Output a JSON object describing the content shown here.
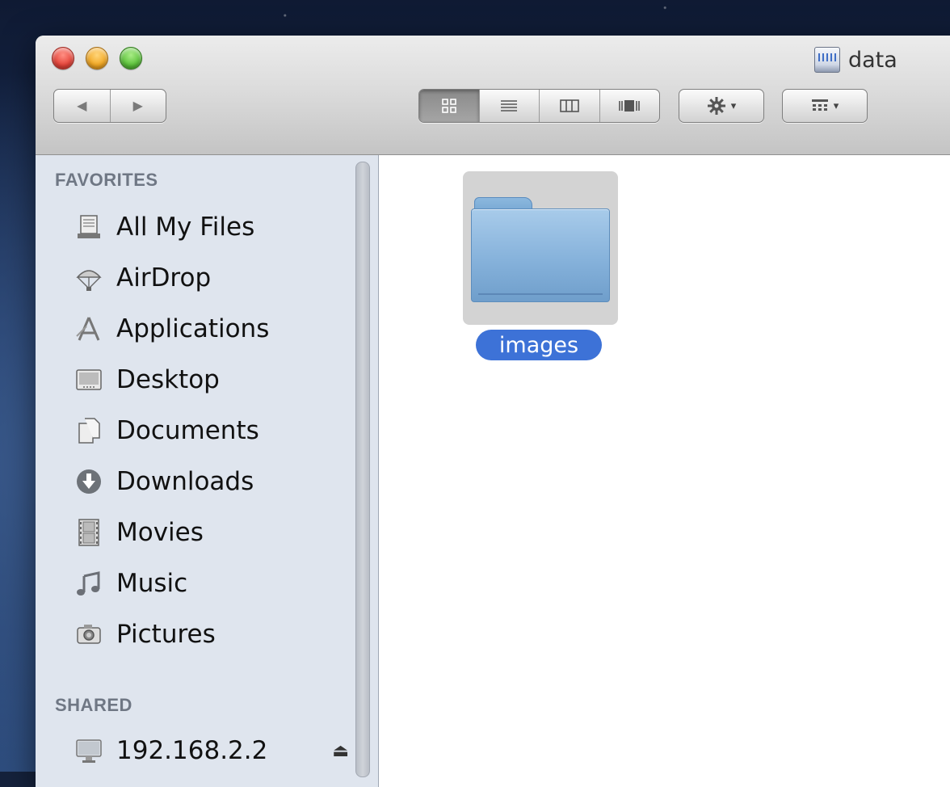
{
  "window": {
    "title": "data"
  },
  "toolbar": {
    "back_icon": "◀",
    "forward_icon": "▶",
    "view_modes": [
      "icon-view",
      "list-view",
      "column-view",
      "cover-flow-view"
    ],
    "action_caret": "▾",
    "arrange_caret": "▾"
  },
  "sidebar": {
    "favorites_title": "FAVORITES",
    "items": [
      {
        "label": "All My Files",
        "icon": "all-my-files"
      },
      {
        "label": "AirDrop",
        "icon": "airdrop"
      },
      {
        "label": "Applications",
        "icon": "applications"
      },
      {
        "label": "Desktop",
        "icon": "desktop"
      },
      {
        "label": "Documents",
        "icon": "documents"
      },
      {
        "label": "Downloads",
        "icon": "downloads"
      },
      {
        "label": "Movies",
        "icon": "movies"
      },
      {
        "label": "Music",
        "icon": "music"
      },
      {
        "label": "Pictures",
        "icon": "pictures"
      }
    ],
    "shared_title": "SHARED",
    "shared_items": [
      {
        "label": "192.168.2.2",
        "icon": "network-computer",
        "eject": "⏏"
      }
    ]
  },
  "content": {
    "items": [
      {
        "name": "images",
        "type": "folder",
        "selected": true
      }
    ]
  },
  "colors": {
    "selection": "#3d72d7",
    "sidebar_bg": "#dfe5ee",
    "folder_blue": "#86b2db"
  }
}
